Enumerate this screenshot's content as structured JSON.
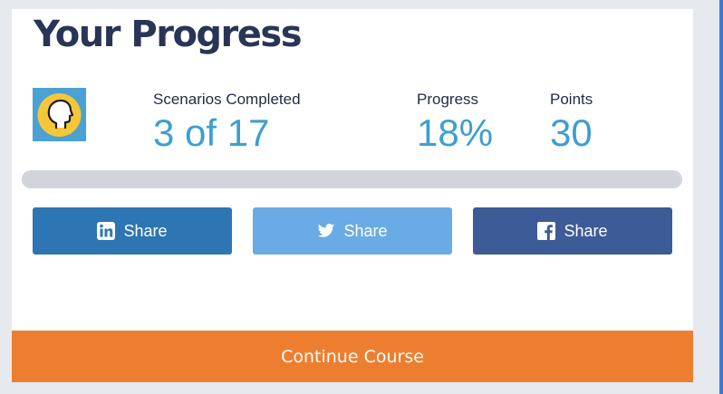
{
  "header": {
    "title": "Your Progress"
  },
  "avatar": {
    "icon": "head-profile-icon",
    "bg_color": "#49a2d3",
    "circle_color": "#f5c638"
  },
  "stats": {
    "scenarios": {
      "label": "Scenarios Completed",
      "value": "3 of 17"
    },
    "progress": {
      "label": "Progress",
      "value": "18%"
    },
    "points": {
      "label": "Points",
      "value": "30"
    }
  },
  "progress_bar": {
    "fraction": 0.18,
    "track_color": "#d1d5db",
    "fill_color": "#d1d5db"
  },
  "share": {
    "linkedin": {
      "label": "Share",
      "icon": "linkedin-icon",
      "color": "#2e75b3"
    },
    "twitter": {
      "label": "Share",
      "icon": "twitter-icon",
      "color": "#6aabe5"
    },
    "facebook": {
      "label": "Share",
      "icon": "facebook-icon",
      "color": "#3d5b96"
    }
  },
  "continue_button": {
    "label": "Continue Course",
    "color": "#ee7e2f"
  }
}
